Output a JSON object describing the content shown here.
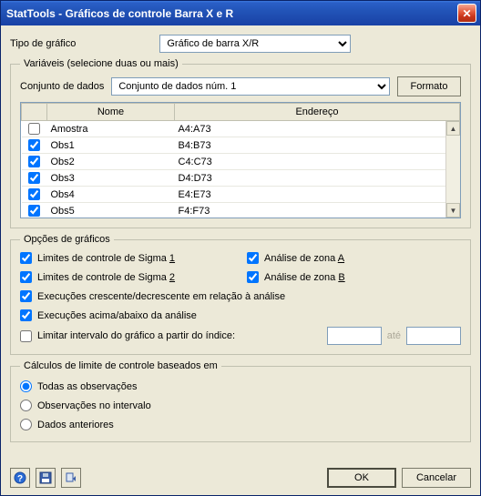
{
  "window": {
    "title": "StatTools - Gráficos de controle Barra X e R"
  },
  "chart_type": {
    "label": "Tipo de gráfico",
    "value": "Gráfico de barra X/R"
  },
  "variables": {
    "legend": "Variáveis (selecione duas ou mais)",
    "dataset_label": "Conjunto de dados",
    "dataset_value": "Conjunto de dados núm. 1",
    "format_button": "Formato",
    "columns": {
      "name": "Nome",
      "address": "Endereço"
    },
    "rows": [
      {
        "checked": false,
        "name": "Amostra",
        "address": "A4:A73"
      },
      {
        "checked": true,
        "name": "Obs1",
        "address": "B4:B73"
      },
      {
        "checked": true,
        "name": "Obs2",
        "address": "C4:C73"
      },
      {
        "checked": true,
        "name": "Obs3",
        "address": "D4:D73"
      },
      {
        "checked": true,
        "name": "Obs4",
        "address": "E4:E73"
      },
      {
        "checked": true,
        "name": "Obs5",
        "address": "F4:F73"
      }
    ]
  },
  "graph_options": {
    "legend": "Opções de gráficos",
    "sigma1": "Limites de controle de Sigma 1",
    "sigma2": "Limites de controle de Sigma 2",
    "zoneA": "Análise de zona A",
    "zoneB": "Análise de zona B",
    "runs_rel": "Execuções crescente/decrescente em relação à análise",
    "runs_above": "Execuções acima/abaixo da análise",
    "limit_label": "Limitar intervalo do gráfico a partir do índice:",
    "limit_sep": "até"
  },
  "calc_limits": {
    "legend": "Cálculos de limite de controle baseados em",
    "opt_all": "Todas as observações",
    "opt_interval": "Observações no intervalo",
    "opt_prior": "Dados anteriores"
  },
  "footer": {
    "ok": "OK",
    "cancel": "Cancelar"
  }
}
